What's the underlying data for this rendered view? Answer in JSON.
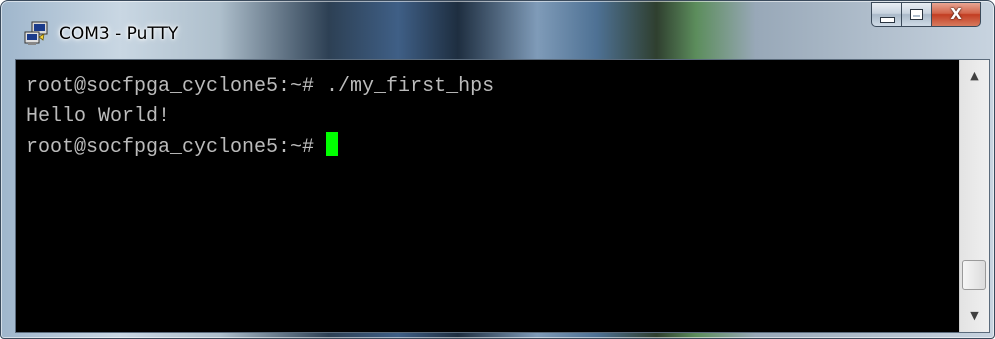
{
  "window": {
    "title": "COM3 - PuTTY",
    "app_icon": "putty-icon",
    "buttons": {
      "minimize_icon": "minimize-icon",
      "maximize_icon": "maximize-icon",
      "close_label": "X"
    }
  },
  "terminal": {
    "lines": [
      "root@socfpga_cyclone5:~# ./my_first_hps",
      "Hello World!",
      "root@socfpga_cyclone5:~# "
    ],
    "cursor_color": "#00ff00",
    "text_color": "#bbbbbb",
    "background_color": "#000000"
  },
  "scrollbar": {
    "up_arrow": "▲",
    "down_arrow": "▼"
  }
}
